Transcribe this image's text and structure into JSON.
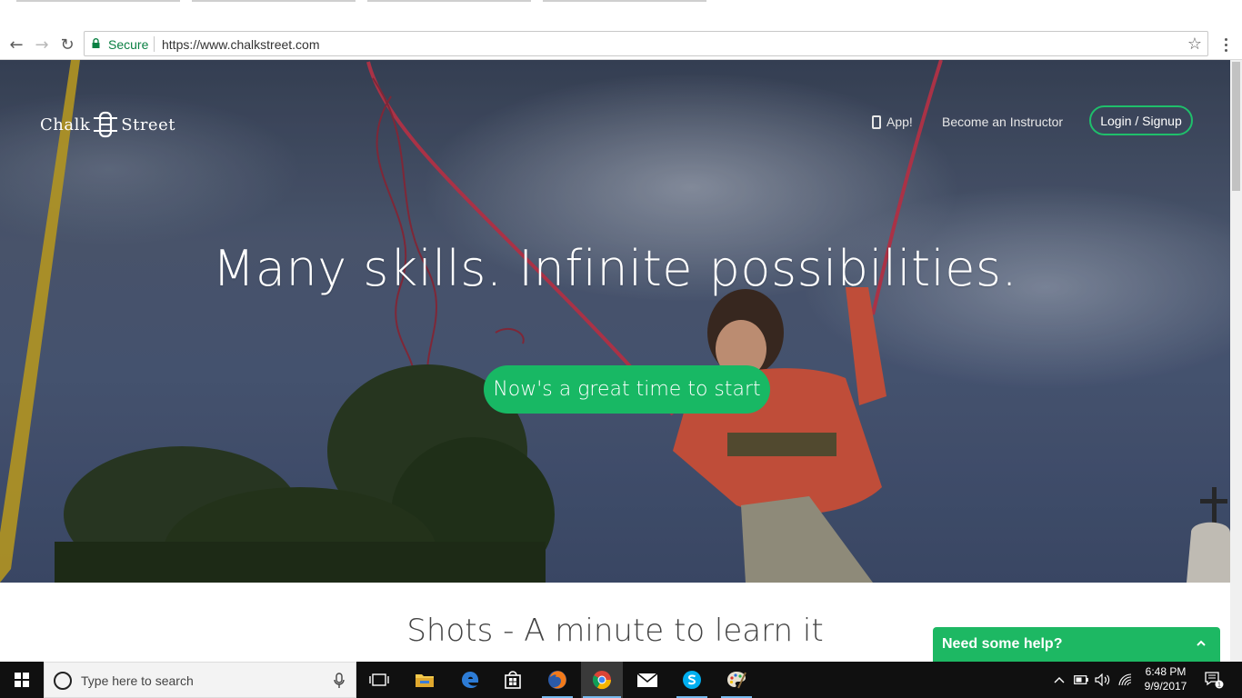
{
  "browser": {
    "secure_label": "Secure",
    "url": "https://www.chalkstreet.com",
    "back_icon": "←",
    "forward_icon": "→",
    "reload_icon": "↻",
    "star_icon": "☆"
  },
  "site": {
    "logo_left": "Chalk",
    "logo_right": "Street",
    "nav": {
      "app_label": "App!",
      "instructor_label": "Become an Instructor",
      "login_label": "Login / Signup"
    },
    "hero": {
      "headline": "Many skills. Infinite possibilities.",
      "cta_label": "Now's a great time to start"
    },
    "section_title": "Shots - A minute to learn it",
    "help_label": "Need some help?"
  },
  "colors": {
    "brand_green": "#1db863",
    "secure_green": "#0b8043"
  },
  "taskbar": {
    "search_placeholder": "Type here to search",
    "time": "6:48 PM",
    "date": "9/9/2017",
    "notification_count": "1",
    "apps": [
      "task-view",
      "file-explorer",
      "edge",
      "store",
      "firefox",
      "chrome",
      "mail",
      "skype",
      "paint"
    ]
  }
}
